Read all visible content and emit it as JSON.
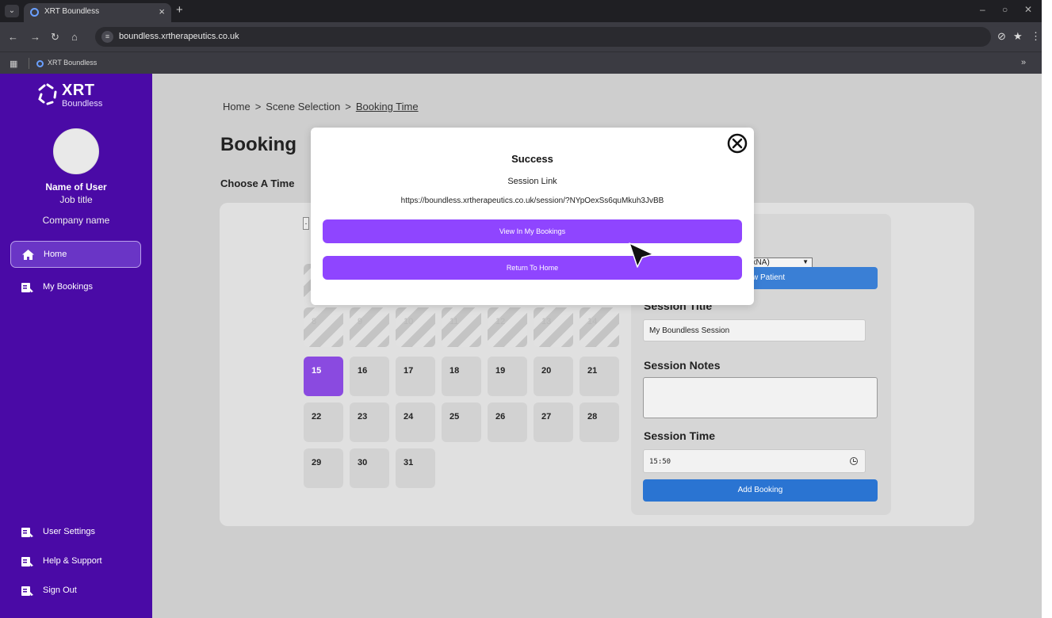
{
  "browser": {
    "tab_title": "XRT Boundless",
    "tab_close": "×",
    "new_tab": "+",
    "url": "boundless.xrtherapeutics.co.uk",
    "bookmark_label": "XRT Boundless",
    "bookmark_more": "»",
    "window_controls": [
      "–",
      "○",
      "✕"
    ]
  },
  "sidebar": {
    "logo_main": "XRT",
    "logo_sub": "Boundless",
    "user_name": "Name of User",
    "job_title": "Job title",
    "company": "Company name",
    "nav": [
      {
        "label": "Home",
        "icon": "home-icon",
        "active": true
      },
      {
        "label": "My Bookings",
        "icon": "bookings-icon",
        "active": false
      }
    ],
    "bottom_nav": [
      {
        "label": "User Settings",
        "icon": "settings-icon"
      },
      {
        "label": "Help & Support",
        "icon": "help-icon"
      },
      {
        "label": "Sign Out",
        "icon": "sign-out-icon"
      }
    ],
    "accent": "#4a0aa6"
  },
  "breadcrumb": {
    "items": [
      "Home",
      "Scene Selection",
      "Booking Time"
    ],
    "separator": ">"
  },
  "page_title": "Booking",
  "choose_time_label": "Choose A Time",
  "calendar": {
    "past_days": [
      "8",
      "9",
      "10",
      "11",
      "12",
      "13",
      "14"
    ],
    "days_row3": [
      "15",
      "16",
      "17",
      "18",
      "19",
      "20",
      "21"
    ],
    "days_row4": [
      "22",
      "23",
      "24",
      "25",
      "26",
      "27",
      "28"
    ],
    "days_row5": [
      "29",
      "30",
      "31"
    ],
    "selected_day": "15",
    "month_selector_glyph": "-"
  },
  "form": {
    "patient_select_value": "LkNA)",
    "new_patient_button": "w Patient",
    "session_title_label": "Session Title",
    "session_title_value": "My Boundless Session",
    "session_notes_label": "Session Notes",
    "session_time_label": "Session Time",
    "session_time_value": "15:50",
    "add_button": "Add Booking"
  },
  "modal": {
    "title": "Success",
    "sublabel": "Session Link",
    "link": "https://boundless.xrtherapeutics.co.uk/session/?NYpOexSs6quMkuh3JvBB",
    "view_button": "View In My Bookings",
    "home_button": "Return To Home",
    "button_color": "#8f45ff"
  }
}
